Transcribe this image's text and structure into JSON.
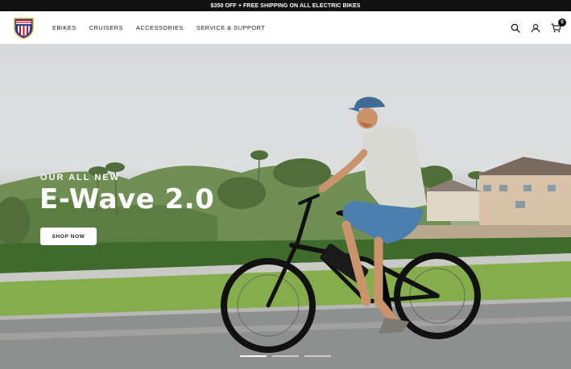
{
  "announcement": {
    "text": "$350 OFF + FREE SHIPPING ON ALL ELECTRIC BIKES"
  },
  "header": {
    "nav": [
      {
        "label": "EBIKES"
      },
      {
        "label": "CRUISERS"
      },
      {
        "label": "ACCESSORIES"
      },
      {
        "label": "SERVICE & SUPPORT"
      }
    ],
    "cart_count": "0",
    "icons": [
      "search-icon",
      "account-icon",
      "cart-icon"
    ]
  },
  "hero": {
    "kicker": "OUR ALL NEW",
    "headline": "E-Wave 2.0",
    "button_label": "SHOP NOW",
    "slides_total": 3,
    "slide_active": 1
  },
  "colors": {
    "announce_bg": "#111111",
    "logo_red": "#c8102e",
    "logo_blue": "#1f3f8f",
    "logo_gold": "#e0b12d"
  }
}
